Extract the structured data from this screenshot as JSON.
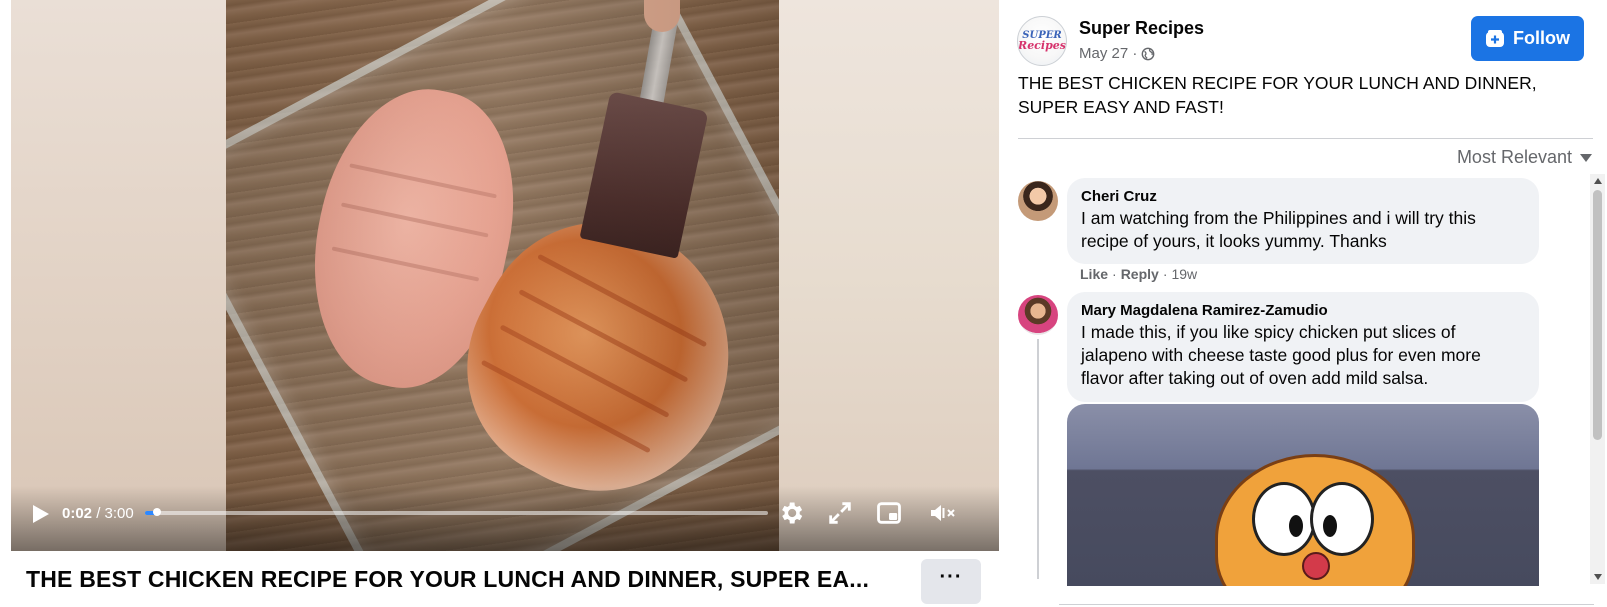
{
  "video": {
    "current_time": "0:02",
    "duration": "/ 3:00",
    "progress_fraction": 0.02,
    "title": "THE BEST CHICKEN RECIPE FOR YOUR LUNCH AND DINNER, SUPER EA...",
    "more_label": "···"
  },
  "post": {
    "page_name": "Super Recipes",
    "logo_line1": "SUPER",
    "logo_line2": "Recipes",
    "date": "May 27 ·",
    "privacy_icon": "globe-icon",
    "follow_label": "Follow",
    "caption": "THE BEST CHICKEN RECIPE FOR YOUR LUNCH AND DINNER, SUPER EASY AND FAST!",
    "sort_label": "Most Relevant"
  },
  "comments": [
    {
      "author": "Cheri Cruz",
      "text": "I am watching from the Philippines and i will try this recipe of yours, it looks yummy. Thanks",
      "like": "Like",
      "sep": "·",
      "reply": "Reply",
      "age": "19w"
    },
    {
      "author": "Mary Magdalena Ramirez-Zamudio",
      "text": "I made this, if you like spicy chicken put slices of jalapeno with cheese taste good plus for even more flavor after taking out of oven add mild salsa."
    }
  ],
  "colors": {
    "follow_blue": "#1b74e4",
    "progress_blue": "#2d88ff",
    "bubble_gray": "#f0f2f5",
    "secondary_text": "#65676b"
  }
}
